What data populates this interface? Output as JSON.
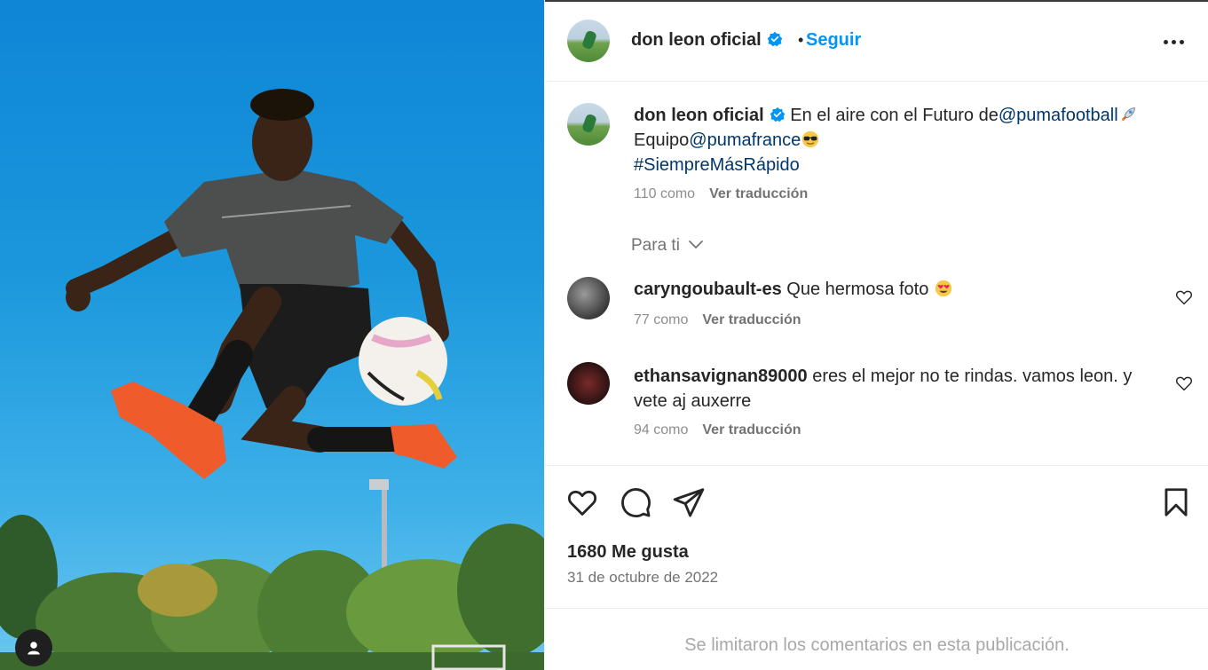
{
  "post": {
    "username": "don leon oficial",
    "follow_label": "Seguir",
    "separator": "•"
  },
  "caption": {
    "username": "don leon oficial",
    "text_1": "En el aire con el Futuro de",
    "mention_1": "@pumafootball",
    "text_2": "Equipo",
    "mention_2": "@pumafrance",
    "hashtag": "#SiempreMásRápido",
    "likes": "110 como",
    "translate": "Ver traducción"
  },
  "comments_filter": {
    "label": "Para ti"
  },
  "comments": [
    {
      "username": "caryngoubault-es",
      "text": "Que hermosa foto",
      "likes": "77 como",
      "translate": "Ver traducción"
    },
    {
      "username": "ethansavignan89000",
      "text": "eres el mejor no te rindas. vamos leon. y vete aj auxerre",
      "likes": "94 como",
      "translate": "Ver traducción"
    }
  ],
  "footer": {
    "likes": "1680 Me gusta",
    "date": "31 de octubre de 2022",
    "limited_notice": "Se limitaron los comentarios en esta publicación."
  },
  "icons": {
    "verified": "verified-badge-icon",
    "more": "more-options-icon",
    "like": "heart-icon",
    "comment": "comment-icon",
    "share": "share-icon",
    "save": "bookmark-icon",
    "user": "user-tag-icon",
    "chevron": "chevron-down-icon"
  },
  "colors": {
    "accent": "#0095f6",
    "link": "#00376b",
    "verified": "#0095f6",
    "muted": "#737373"
  }
}
